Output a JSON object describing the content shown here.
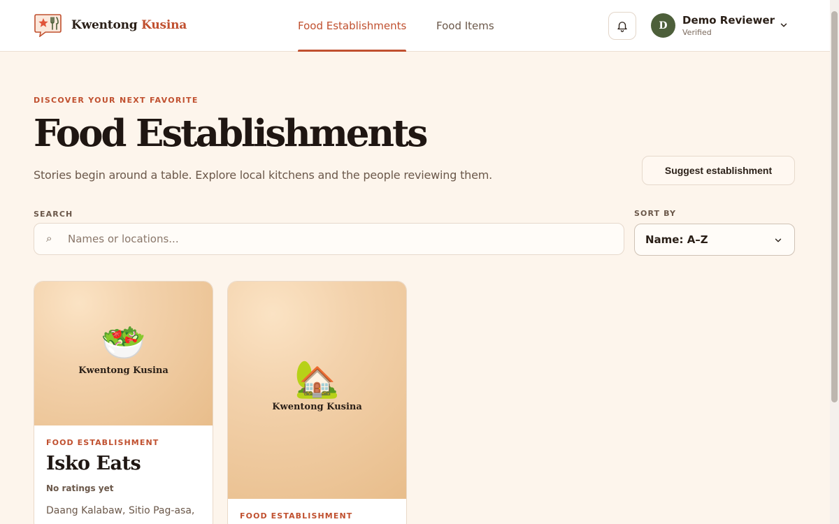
{
  "brand": {
    "name_part1": "Kwentong",
    "name_part2": "Kusina",
    "logo_icon": "chat-bubble-star-utensils-icon"
  },
  "nav": {
    "items": [
      {
        "label": "Food Establishments",
        "active": true
      },
      {
        "label": "Food Items",
        "active": false
      }
    ]
  },
  "header": {
    "notifications_icon": "bell-icon"
  },
  "user": {
    "initial": "D",
    "name": "Demo Reviewer",
    "status": "Verified"
  },
  "hero": {
    "eyebrow": "DISCOVER YOUR NEXT FAVORITE",
    "title": "Food Establishments",
    "subtitle": "Stories begin around a table. Explore local kitchens and the people reviewing them.",
    "suggest_button": "Suggest establishment"
  },
  "filters": {
    "search_label": "SEARCH",
    "search_placeholder": "Names or locations...",
    "search_value": "",
    "sort_label": "SORT BY",
    "sort_value": "Name: A–Z"
  },
  "cards": [
    {
      "image_emoji": "🥗",
      "image_caption": "Kwentong Kusina",
      "kicker": "FOOD ESTABLISHMENT",
      "title": "Isko Eats",
      "rating": "No ratings yet",
      "location": "Daang Kalabaw, Sitio Pag-asa,"
    },
    {
      "image_emoji": "🏡",
      "image_caption": "Kwentong Kusina",
      "kicker": "FOOD ESTABLISHMENT"
    }
  ],
  "colors": {
    "accent": "#c0502f",
    "background": "#fdf5ec",
    "avatar": "#4d5f3a"
  }
}
